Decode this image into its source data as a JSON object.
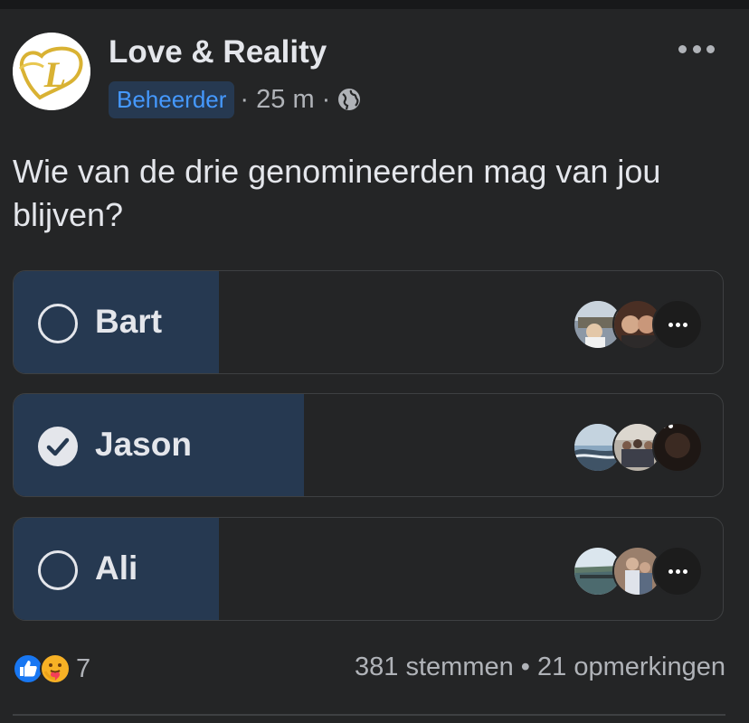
{
  "post": {
    "page_name": "Love & Reality",
    "role_badge": "Beheerder",
    "time": "· 25 m ·",
    "privacy_icon": "globe-icon",
    "more_icon": "more-horizontal-icon",
    "question": "Wie van de drie genomineerden mag van jou blijven?"
  },
  "poll": {
    "options": [
      {
        "label": "Bart",
        "selected": false,
        "fill_fraction": 0.29
      },
      {
        "label": "Jason",
        "selected": true,
        "fill_fraction": 0.41
      },
      {
        "label": "Ali",
        "selected": false,
        "fill_fraction": 0.29
      }
    ]
  },
  "footer": {
    "reaction_icons": [
      "like-icon",
      "care-icon"
    ],
    "reaction_count": "7",
    "votes": "381 stemmen",
    "separator": "•",
    "comments": "21 opmerkingen"
  },
  "colors": {
    "background": "#242526",
    "poll_fill": "#263951",
    "badge_text": "#4599ff",
    "primary_text": "#e4e6eb",
    "secondary_text": "#b0b3b8"
  }
}
